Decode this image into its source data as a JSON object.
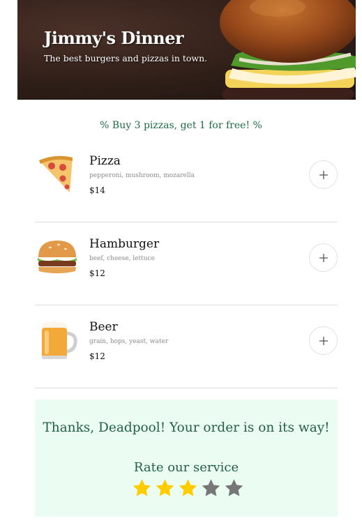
{
  "hero": {
    "title": "Jimmy's Dinner",
    "subtitle": "The best burgers and pizzas in town."
  },
  "promo": "% Buy 3 pizzas, get 1 for free! %",
  "menu": {
    "items": [
      {
        "name": "Pizza",
        "description": "pepperoni, mushroom, mozarella",
        "price": "$14",
        "icon": "pizza-icon"
      },
      {
        "name": "Hamburger",
        "description": "beef, cheese, lettuce",
        "price": "$12",
        "icon": "hamburger-icon"
      },
      {
        "name": "Beer",
        "description": "grain, hops, yeast, water",
        "price": "$12",
        "icon": "beer-icon"
      }
    ]
  },
  "order": {
    "message": "Thanks, Deadpool! Your order is on its way!",
    "rate_label": "Rate our service",
    "rating": 3,
    "max_rating": 5
  },
  "colors": {
    "accent": "#235f45",
    "panel_bg": "#ebfdf3",
    "star_on": "#ffcc00",
    "star_off": "#777777"
  }
}
